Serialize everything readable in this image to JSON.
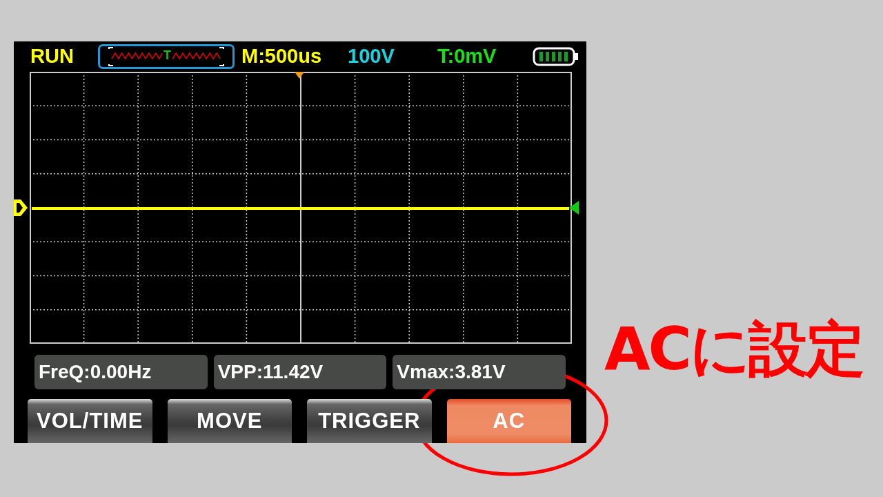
{
  "status": "RUN",
  "trigger_marker": "T",
  "timebase": "M:500us",
  "volts_per_div": "100V",
  "trigger_level": "T:0mV",
  "measurements": [
    "FreQ:0.00Hz",
    "VPP:11.42V",
    "Vmax:3.81V"
  ],
  "buttons": [
    {
      "label": "VOL/TIME",
      "selected": false
    },
    {
      "label": "MOVE",
      "selected": false
    },
    {
      "label": "TRIGGER",
      "selected": false
    },
    {
      "label": "AC",
      "selected": true
    }
  ],
  "annotation": "ACに設定"
}
